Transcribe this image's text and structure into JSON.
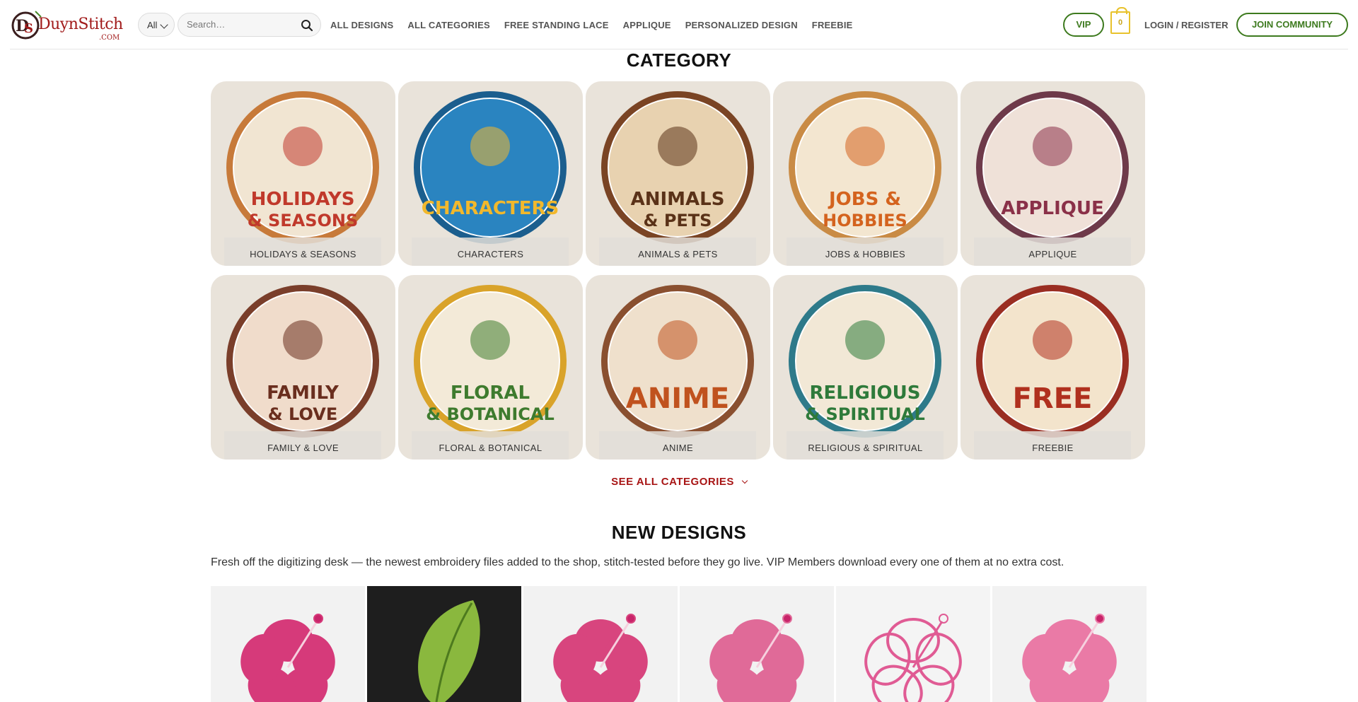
{
  "header": {
    "logo_text": "DuynStitch",
    "logo_sub": ".COM",
    "category_select": "All",
    "search_placeholder": "Search…",
    "nav": [
      "ALL DESIGNS",
      "ALL CATEGORIES",
      "FREE STANDING LACE",
      "APPLIQUE",
      "PERSONALIZED DESIGN",
      "FREEBIE"
    ],
    "vip_label": "VIP",
    "cart_count": "0",
    "login_label": "LOGIN / REGISTER",
    "join_label": "JOIN COMMUNITY"
  },
  "category_section": {
    "title": "CATEGORY",
    "categories": [
      {
        "label": "HOLIDAYS & SEASONS",
        "badge_line1": "HOLIDAYS",
        "badge_line2": "& SEASONS",
        "ring": "#c77a3a",
        "fill": "#f1e5d2",
        "text_color": "#c0392b"
      },
      {
        "label": "CHARACTERS",
        "badge_line1": "",
        "badge_line2": "CHARACTERS",
        "ring": "#1b5e8e",
        "fill": "#2a84c0",
        "text_color": "#f2b82c"
      },
      {
        "label": "ANIMALS & PETS",
        "badge_line1": "ANIMALS",
        "badge_line2": "& PETS",
        "ring": "#7a4424",
        "fill": "#e8d2b0",
        "text_color": "#5a3218"
      },
      {
        "label": "JOBS & HOBBIES",
        "badge_line1": "JOBS &",
        "badge_line2": "HOBBIES",
        "ring": "#c98b45",
        "fill": "#f3e6d0",
        "text_color": "#d4631e"
      },
      {
        "label": "APPLIQUE",
        "badge_line1": "",
        "badge_line2": "APPLIQUE",
        "ring": "#6e3a4a",
        "fill": "#efe1d8",
        "text_color": "#8a3048"
      },
      {
        "label": "FAMILY & LOVE",
        "badge_line1": "FAMILY",
        "badge_line2": "& LOVE",
        "ring": "#7a3e2a",
        "fill": "#f0dccb",
        "text_color": "#6a2e1e"
      },
      {
        "label": "FLORAL & BOTANICAL",
        "badge_line1": "FLORAL",
        "badge_line2": "& BOTANICAL",
        "ring": "#d9a32a",
        "fill": "#f3ead8",
        "text_color": "#3e7b2e"
      },
      {
        "label": "ANIME",
        "badge_line1": "",
        "badge_line2": "ANIME",
        "ring": "#8a5030",
        "fill": "#efe0cc",
        "text_color": "#c0521e"
      },
      {
        "label": "RELIGIOUS & SPIRITUAL",
        "badge_line1": "RELIGIOUS",
        "badge_line2": "& SPIRITUAL",
        "ring": "#2e7a8a",
        "fill": "#f2e8d6",
        "text_color": "#2e7a3a"
      },
      {
        "label": "FREEBIE",
        "badge_line1": "",
        "badge_line2": "FREE",
        "ring": "#9a2e22",
        "fill": "#f3e4cc",
        "text_color": "#b0301e"
      }
    ],
    "see_all_label": "SEE ALL CATEGORIES"
  },
  "new_designs": {
    "title": "NEW DESIGNS",
    "description": "Fresh off the digitizing desk — the newest embroidery files added to the shop, stitch-tested before they go live. VIP Members download every one of them at no extra cost.",
    "designs": [
      {
        "subject": "pink-hibiscus-with-leaf",
        "bg": "#f2f2f2",
        "color": "#d63a7a"
      },
      {
        "subject": "green-leaf",
        "bg": "#1e1e1e",
        "color": "#8ab83e"
      },
      {
        "subject": "pink-hibiscus-with-stem",
        "bg": "#f2f2f2",
        "color": "#d8457e"
      },
      {
        "subject": "pink-hibiscus-bloom",
        "bg": "#f2f2f2",
        "color": "#e06a98"
      },
      {
        "subject": "hibiscus-outline",
        "bg": "#f4f4f4",
        "color": "#e05b94"
      },
      {
        "subject": "light-pink-hibiscus",
        "bg": "#f2f2f2",
        "color": "#ea7aa6"
      }
    ]
  },
  "colors": {
    "accent_red": "#a81515",
    "brand_green": "#3d7a1e",
    "cart_yellow": "#e8c22c"
  }
}
